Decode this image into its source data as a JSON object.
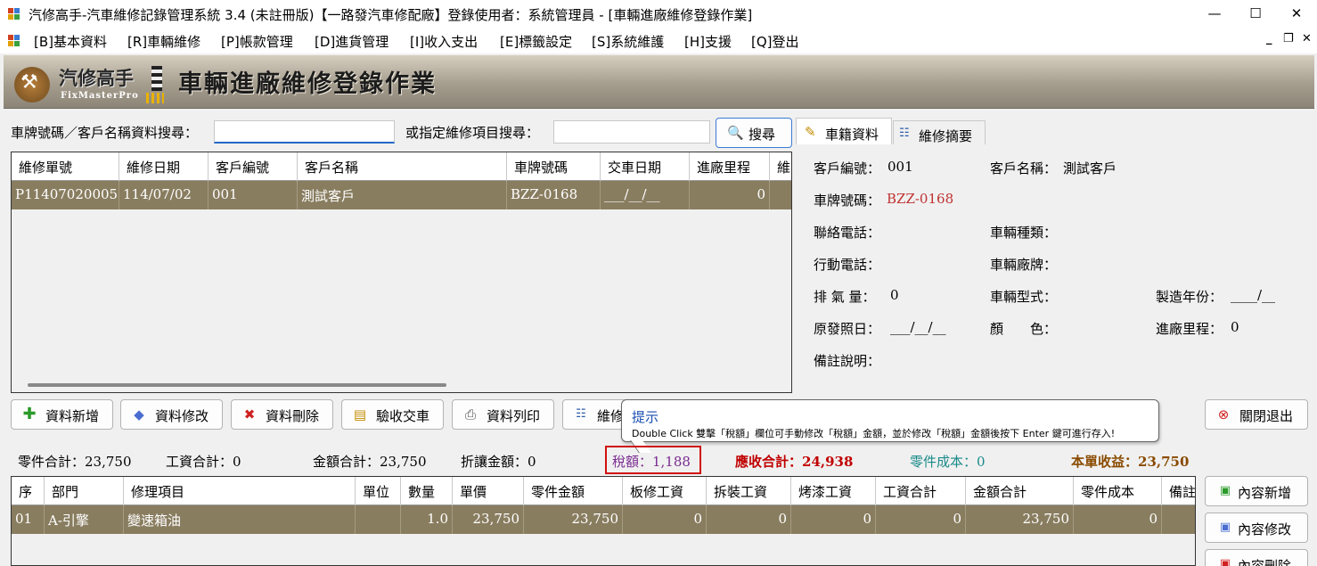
{
  "window": {
    "title": "汽修高手-汽車維修記錄管理系統 3.4 (未註冊版)【一路發汽車修配廠】登錄使用者：系統管理員 - [車輛進廠維修登錄作業]",
    "minimize": "—",
    "maximize": "☐",
    "close": "✕"
  },
  "menu": {
    "items": [
      "[B]基本資料",
      "[R]車輛維修",
      "[P]帳款管理",
      "[D]進貨管理",
      "[I]收入支出",
      "[E]標籤設定",
      "[S]系統維護",
      "[H]支援",
      "[Q]登出"
    ],
    "mdi_minimize": "_",
    "mdi_restore": "❐",
    "mdi_close": "✕"
  },
  "banner": {
    "logo_name": "汽修高手",
    "logo_sub": "FixMasterPro",
    "title": "車輛進廠維修登錄作業"
  },
  "search": {
    "plate_label": "車牌號碼／客戶名稱資料搜尋：",
    "plate_value": "",
    "item_label": "或指定維修項目搜尋：",
    "item_value": "",
    "search_button": "搜尋"
  },
  "tabs": {
    "vehicle": "車籍資料",
    "summary": "維修摘要"
  },
  "orders": {
    "columns": [
      "維修單號",
      "維修日期",
      "客戶編號",
      "客戶名稱",
      "車牌號碼",
      "交車日期",
      "進廠里程",
      "維"
    ],
    "rows": [
      [
        "P11407020005",
        "114/07/02",
        "001",
        "測試客戶",
        "BZZ-0168",
        "___/__/__",
        "0"
      ]
    ]
  },
  "vehicle": {
    "customer_no_label": "客戶編號：",
    "customer_no": "001",
    "customer_name_label": "客戶名稱：",
    "customer_name": "測試客戶",
    "plate_label": "車牌號碼：",
    "plate": "BZZ-0168",
    "phone_label": "聯絡電話：",
    "vehicle_type_label": "車輛種類：",
    "mobile_label": "行動電話：",
    "brand_label": "車輛廠牌：",
    "displacement_label": "排 氣 量：",
    "displacement": "0",
    "model_label": "車輛型式：",
    "year_label": "製造年份：",
    "year": "____/__",
    "license_date_label": "原發照日：",
    "license_date": "___/__/__",
    "color_label": "顏　　色：",
    "mileage_label": "進廠里程：",
    "mileage": "0",
    "remark_label": "備註說明："
  },
  "actions": {
    "add": "資料新增",
    "edit": "資料修改",
    "delete": "資料刪除",
    "deliver": "驗收交車",
    "print": "資料列印",
    "maint": "維修",
    "close": "關閉退出"
  },
  "tooltip": {
    "title": "提示",
    "body": "Double Click 雙擊「稅額」欄位可手動修改「稅額」金額，並於修改「稅額」金額後按下 Enter 鍵可進行存入!"
  },
  "totals": {
    "parts": "零件合計：23,750",
    "labor": "工資合計：0",
    "amount": "金額合計：23,750",
    "discount": "折讓金額：0",
    "tax": "稅額：1,188",
    "receivable": "應收合計：24,938",
    "parts_cost": "零件成本：0",
    "profit": "本單收益：23,750"
  },
  "items": {
    "columns": [
      "序",
      "部門",
      "修理項目",
      "單位",
      "數量",
      "單價",
      "零件金額",
      "板修工資",
      "拆裝工資",
      "烤漆工資",
      "工資合計",
      "金額合計",
      "零件成本",
      "備註"
    ],
    "rows": [
      [
        "01",
        "A-引擎",
        "變速箱油",
        "",
        "1.0",
        "23,750",
        "23,750",
        "0",
        "0",
        "0",
        "0",
        "23,750",
        "0",
        ""
      ]
    ]
  },
  "item_actions": {
    "add": "內容新增",
    "edit": "內容修改",
    "delete": "內容刪除"
  },
  "colors": {
    "selected_row": "#897d60",
    "plate": "#c03030",
    "receivable": "#c00000",
    "parts_cost": "#1a8a8a",
    "profit": "#8a4a00",
    "tax": "#7a2a90"
  }
}
